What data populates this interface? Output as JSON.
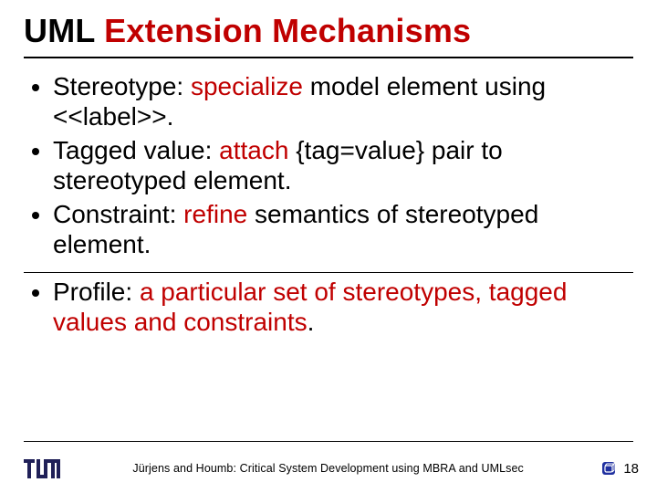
{
  "title": {
    "plain": "UML ",
    "accent": "Extension Mechanisms"
  },
  "bullets": [
    {
      "lead": "Stereotype: ",
      "accent": "specialize",
      "rest": " model element using <<label>>."
    },
    {
      "lead": "Tagged value: ",
      "accent": "attach",
      "rest": " {tag=value} pair to stereotyped element."
    },
    {
      "lead": "Constraint: ",
      "accent": "refine",
      "rest": " semantics of stereotyped element."
    }
  ],
  "profile": {
    "lead": "Profile: ",
    "accent": "a particular set of stereotypes, tagged values and constraints",
    "rest": "."
  },
  "footer": {
    "text": "Jürjens and Houmb: Critical System Development using MBRA and UMLsec",
    "page": "18"
  },
  "logos": {
    "left": "tum-logo",
    "right": "uml-cube-icon"
  }
}
